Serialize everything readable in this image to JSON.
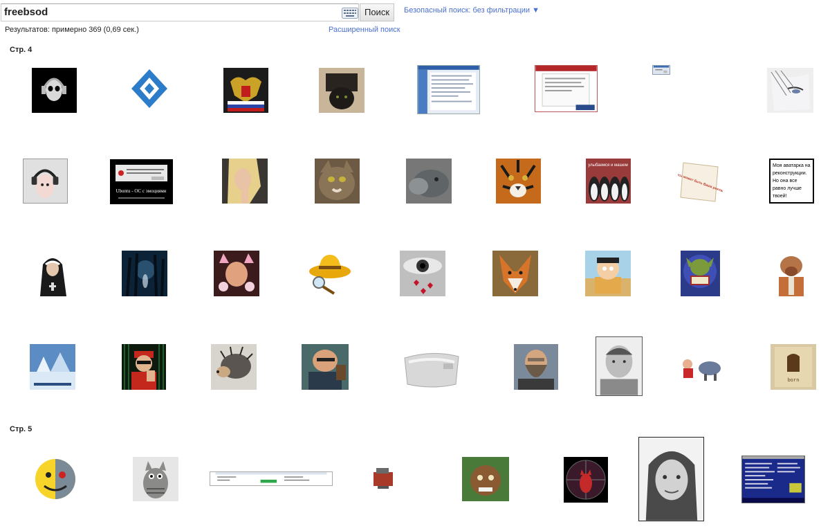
{
  "search": {
    "query": "freebsod",
    "button_label": "Поиск"
  },
  "safe_search": "Безопасный поиск: без фильтрации ▼",
  "results_stats": "Результатов: примерно 369 (0,69 сек.)",
  "advanced_search": "Расширенный поиск",
  "pages": [
    {
      "label": "Стр. 4"
    },
    {
      "label": "Стр. 5"
    }
  ],
  "thumbnails": [
    {
      "name": "skull-headphones"
    },
    {
      "name": "blue-logo"
    },
    {
      "name": "russian-coat-of-arms"
    },
    {
      "name": "cat-in-fur-hat"
    },
    {
      "name": "web-page-screenshot-blue"
    },
    {
      "name": "web-page-screenshot-red"
    },
    {
      "name": "tiny-window"
    },
    {
      "name": "anime-face-sketch"
    },
    {
      "name": "pink-creature-headphones"
    },
    {
      "name": "ubuntu-error-dialog",
      "caption": "Ubuntu - ОС с эмоциями"
    },
    {
      "name": "blonde-woman"
    },
    {
      "name": "tabby-cat"
    },
    {
      "name": "grey-cat"
    },
    {
      "name": "tiger-face"
    },
    {
      "name": "penguins",
      "caption": "улыбаемся и машем"
    },
    {
      "name": "ad-space-note",
      "caption": "Здесь может быть Ваша реклама"
    },
    {
      "name": "avatar-text",
      "caption": "Моя аватарка на реконструкции. Но она все равно лучше твоей!"
    },
    {
      "name": "nun"
    },
    {
      "name": "dark-forest"
    },
    {
      "name": "girl-cat-ears"
    },
    {
      "name": "yellow-hat-magnifier"
    },
    {
      "name": "eye-hearts"
    },
    {
      "name": "fox"
    },
    {
      "name": "south-park-character"
    },
    {
      "name": "gremlin-reading"
    },
    {
      "name": "alf"
    },
    {
      "name": "winter-scene"
    },
    {
      "name": "matrix-man"
    },
    {
      "name": "hedgehog"
    },
    {
      "name": "cartoon-man"
    },
    {
      "name": "silver-bag"
    },
    {
      "name": "bearded-man"
    },
    {
      "name": "man-portrait"
    },
    {
      "name": "cartoon-bull"
    },
    {
      "name": "fist-poster",
      "caption": "born"
    },
    {
      "name": "half-robot-smiley"
    },
    {
      "name": "knitted-cat"
    },
    {
      "name": "download-window"
    },
    {
      "name": "small-red-object"
    },
    {
      "name": "cartoon-character"
    },
    {
      "name": "red-cat-scope"
    },
    {
      "name": "girl-portrait"
    },
    {
      "name": "blue-screen"
    }
  ],
  "colors": {
    "link": "#4a6fcd",
    "button_border": "#c4c4c4"
  }
}
